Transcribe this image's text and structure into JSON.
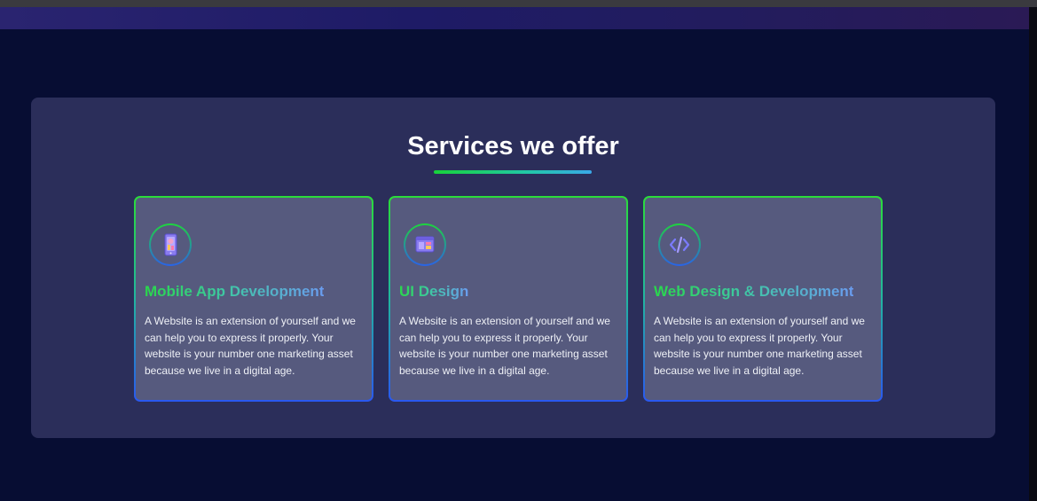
{
  "section": {
    "title": "Services we offer"
  },
  "services": [
    {
      "icon": "mobile-app-icon",
      "title": "Mobile App Development",
      "description": "A Website is an extension of yourself and we can help you to express it properly. Your website is your number one marketing asset because we live in a digital age."
    },
    {
      "icon": "ui-design-icon",
      "title": "UI Design",
      "description": "A Website is an extension of yourself and we can help you to express it properly. Your website is your number one marketing asset because we live in a digital age."
    },
    {
      "icon": "code-icon",
      "title": "Web Design & Development",
      "description": "A Website is an extension of yourself and we can help you to express it properly. Your website is your number one marketing asset because we live in a digital age."
    }
  ],
  "colors": {
    "page_background": "#070d33",
    "panel_background": "#2b2e5a",
    "card_background": "#565a7e",
    "accent_green": "#29d84a",
    "accent_blue": "#2a58f0"
  }
}
